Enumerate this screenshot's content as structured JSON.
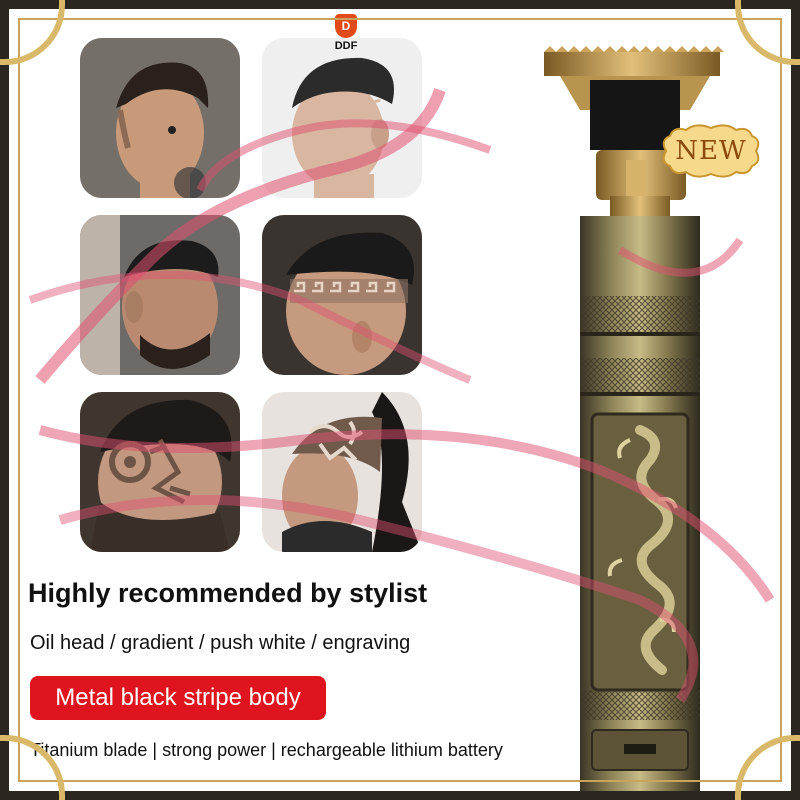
{
  "brand": {
    "name": "DDF",
    "mark": "D"
  },
  "badge": {
    "label": "NEW"
  },
  "headline": "Highly recommended by stylist",
  "styles_line": "Oil head / gradient / push white / engraving",
  "body_pill": "Metal black stripe body",
  "features_line": "Titanium blade | strong power | rechargeable lithium battery",
  "gallery": [
    {
      "icon": "fade-haircut-photo"
    },
    {
      "icon": "line-design-haircut-photo"
    },
    {
      "icon": "slick-back-fade-photo"
    },
    {
      "icon": "greek-key-engraving-photo"
    },
    {
      "icon": "flower-engraving-photo"
    },
    {
      "icon": "tribal-engraving-photo"
    }
  ],
  "colors": {
    "accent_red": "#e0141e",
    "gold": "#c9a45a",
    "bronze": "#8a7a4a",
    "ribbon": "#e05070"
  }
}
